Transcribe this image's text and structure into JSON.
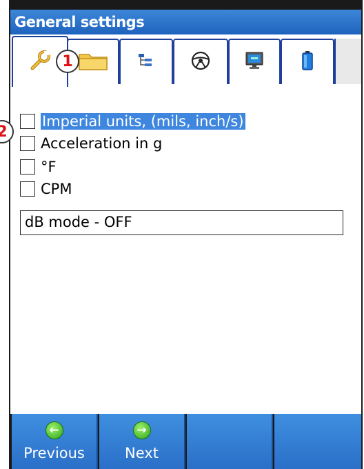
{
  "window": {
    "title": "General settings"
  },
  "tabs": [
    {
      "icon": "wrench-icon"
    },
    {
      "icon": "folder-icon"
    },
    {
      "icon": "tree-icon"
    },
    {
      "icon": "steering-wheel-icon"
    },
    {
      "icon": "monitor-icon"
    },
    {
      "icon": "battery-icon"
    }
  ],
  "settings": {
    "checkboxes": [
      {
        "label": "Imperial units, (mils, inch/s)",
        "checked": false,
        "selected": true
      },
      {
        "label": "Acceleration in g",
        "checked": false,
        "selected": false
      },
      {
        "label": "°F",
        "checked": false,
        "selected": false
      },
      {
        "label": "CPM",
        "checked": false,
        "selected": false
      }
    ],
    "db_mode": "dB mode - OFF"
  },
  "callouts": {
    "c1": "1",
    "c2": "2"
  },
  "bottom": {
    "previous_label": "Previous",
    "next_label": "Next"
  },
  "colors": {
    "title_blue": "#1e63bd",
    "selection": "#3f87de",
    "tab_border": "#1f3f9a"
  }
}
